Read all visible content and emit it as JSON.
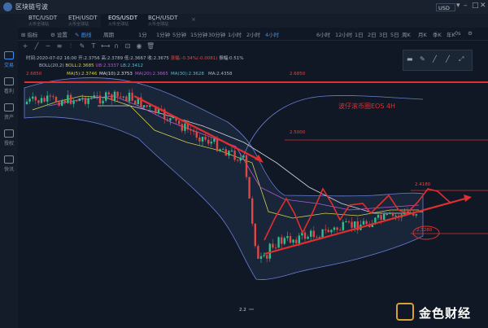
{
  "app": {
    "title": "区块链号波",
    "currency": "USD"
  },
  "sidebar": {
    "items": [
      {
        "label": "交易",
        "active": true
      },
      {
        "label": "看利",
        "active": false
      },
      {
        "label": "资产",
        "active": false
      },
      {
        "label": "授权",
        "active": false
      },
      {
        "label": "快讯",
        "active": false
      }
    ]
  },
  "tabs": [
    {
      "pair": "BTC/USDT",
      "sub": "火币全球站"
    },
    {
      "pair": "ETH/USDT",
      "sub": "火币全球站"
    },
    {
      "pair": "EOS/USDT",
      "sub": "火币全球站"
    },
    {
      "pair": "BCH/USDT",
      "sub": "火币全球站"
    }
  ],
  "toolbar": {
    "indicator": "指标",
    "settings": "设置",
    "draw": "画线",
    "period_label": "周期",
    "intervals": [
      "1分",
      "1分钟",
      "5分钟",
      "15分钟",
      "30分钟",
      "1小时",
      "2小时",
      "4小时",
      "6小时",
      "12小时",
      "1日",
      "2日",
      "3日",
      "5日",
      "周K",
      "月K",
      "季K",
      "年K"
    ],
    "active_interval": "4小时",
    "right": [
      "0s",
      "⚙"
    ]
  },
  "ohlc": {
    "time": "时间:2020-07-02 16:00",
    "open": "开:2.3756",
    "high": "高:2.3789",
    "low": "低:2.3667",
    "close": "收:2.3675",
    "change_pct": "涨幅:-0.34%(-0.0081)",
    "amplitude": "振幅:0.51%"
  },
  "boll": {
    "label": "BOLL(20,2)",
    "boll": "BOLL:2.3685",
    "ub": "UB:2.3337",
    "lb": "LB:2.3412"
  },
  "ma": [
    {
      "label": "MA(5):2.3746",
      "color": "#d6d04a"
    },
    {
      "label": "MA(10):2.3753",
      "color": "#e0e0e0"
    },
    {
      "label": "MA(20):2.3665",
      "color": "#b35cd1"
    },
    {
      "label": "MA(30):2.3628",
      "color": "#5cb8d1"
    },
    {
      "label": "MA:2.4358",
      "color": "#aab4c0"
    }
  ],
  "price_labels": {
    "top": "2.6850",
    "left_top": "2.6850",
    "mid": "2.5000",
    "right_mid": "2.4180",
    "right_low": "2.3280",
    "low": "2.2"
  },
  "annotation": "波仔滚币圈EOS 4H",
  "watermark": "金色财经"
}
